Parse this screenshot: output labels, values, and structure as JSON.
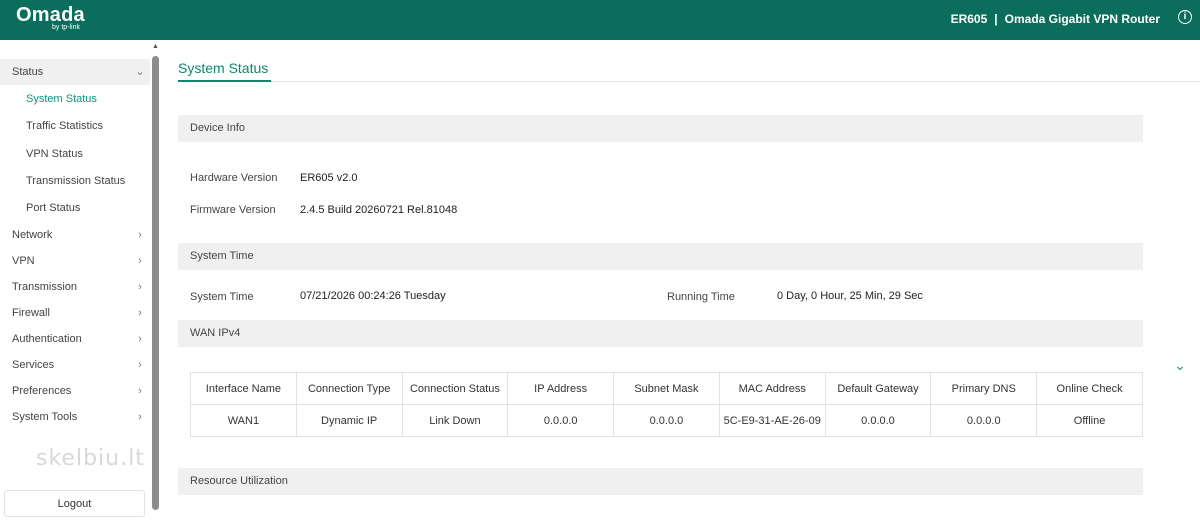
{
  "header": {
    "logo": "Omada",
    "logo_sub": "by tp-link",
    "model": "ER605",
    "separator": "|",
    "device_name": "Omada Gigabit VPN Router",
    "info_glyph": "i",
    "icon": "info-icon"
  },
  "sidebar": {
    "groups": [
      {
        "label": "Status",
        "expanded": true
      },
      {
        "label": "Network"
      },
      {
        "label": "VPN"
      },
      {
        "label": "Transmission"
      },
      {
        "label": "Firewall"
      },
      {
        "label": "Authentication"
      },
      {
        "label": "Services"
      },
      {
        "label": "Preferences"
      },
      {
        "label": "System Tools"
      }
    ],
    "status_items": [
      {
        "label": "System Status",
        "active": true
      },
      {
        "label": "Traffic Statistics"
      },
      {
        "label": "VPN Status"
      },
      {
        "label": "Transmission Status"
      },
      {
        "label": "Port Status"
      }
    ],
    "logout_label": "Logout",
    "watermark": "skelbiu.lt"
  },
  "main": {
    "tab": "System Status",
    "device_info": {
      "title": "Device Info",
      "hardware_label": "Hardware Version",
      "hardware_value": "ER605 v2.0",
      "firmware_label": "Firmware Version",
      "firmware_value": "2.4.5 Build 20260721 Rel.81048"
    },
    "system_time": {
      "title": "System Time",
      "time_label": "System Time",
      "time_value": "07/21/2026 00:24:26 Tuesday",
      "running_label": "Running Time",
      "running_value": "0 Day, 0 Hour, 25 Min, 29 Sec"
    },
    "wan": {
      "title": "WAN IPv4",
      "columns": [
        "Interface Name",
        "Connection Type",
        "Connection Status",
        "IP Address",
        "Subnet Mask",
        "MAC Address",
        "Default Gateway",
        "Primary DNS",
        "Online Check"
      ],
      "rows": [
        [
          "WAN1",
          "Dynamic IP",
          "Link Down",
          "0.0.0.0",
          "0.0.0.0",
          "5C-E9-31-AE-26-09",
          "0.0.0.0",
          "0.0.0.0",
          "Offline"
        ]
      ]
    },
    "resource": {
      "title": "Resource Utilization"
    }
  },
  "colors": {
    "brand": "#0b6e5d",
    "accent": "#0b8a6e",
    "active_text": "#0b9a7a"
  }
}
